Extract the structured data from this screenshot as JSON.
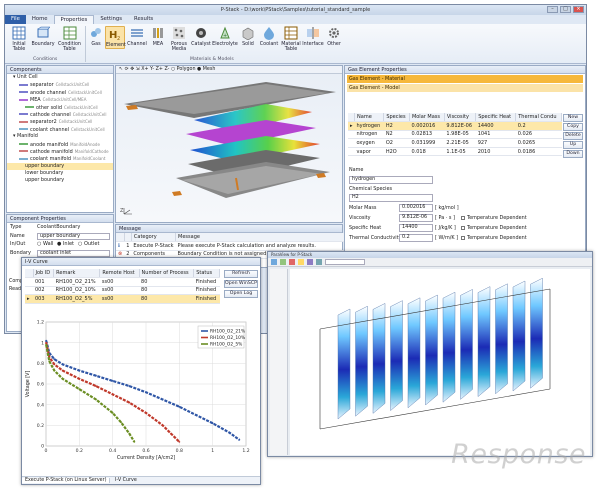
{
  "main_window": {
    "title": "P-Stack - D:\\work\\PStack\\Samples\\tutorial_standard_sample",
    "menu_tabs": [
      "File",
      "Home",
      "Properties",
      "Settings",
      "Results"
    ],
    "active_tab": "Properties",
    "ribbon": {
      "buttons": [
        {
          "label": "Initial\nTable",
          "icon": "table-icon"
        },
        {
          "label": "Boundary",
          "icon": "boundary-icon"
        },
        {
          "label": "Condition\nTable",
          "icon": "condition-table-icon"
        },
        {
          "label": "Gas",
          "icon": "gas-icon"
        },
        {
          "label": "Element",
          "icon": "h2-element-icon"
        },
        {
          "label": "Channel",
          "icon": "channel-icon"
        },
        {
          "label": "MEA",
          "icon": "mea-icon"
        },
        {
          "label": "Porous\nMedia",
          "icon": "porous-media-icon"
        },
        {
          "label": "Catalyst",
          "icon": "catalyst-icon"
        },
        {
          "label": "Electrolyte",
          "icon": "electrolyte-icon"
        },
        {
          "label": "Solid",
          "icon": "solid-icon"
        },
        {
          "label": "Coolant",
          "icon": "coolant-icon"
        },
        {
          "label": "Material\nTable",
          "icon": "material-table-icon"
        },
        {
          "label": "Interface",
          "icon": "interface-icon"
        },
        {
          "label": "Other",
          "icon": "gear-icon"
        }
      ],
      "groups": [
        "Conditions",
        "Materials & Models"
      ]
    },
    "components_panel": {
      "title": "Components",
      "items": [
        {
          "label": "Unit Cell",
          "indent": 1,
          "color": ""
        },
        {
          "label": "separator",
          "indent": 2,
          "color": "#7b7bd0",
          "tag": "CellstackUnitCell"
        },
        {
          "label": "anode channel",
          "indent": 2,
          "color": "#7b7bd0",
          "tag": "CellstackUnitCell"
        },
        {
          "label": "MEA",
          "indent": 2,
          "color": "#b06ad9",
          "tag": "CellstackUnitCell/MEA"
        },
        {
          "label": "other solid",
          "indent": 3,
          "color": "#6cb36c",
          "tag": "CellstackUnitCell"
        },
        {
          "label": "cathode channel",
          "indent": 2,
          "color": "#7b7bd0",
          "tag": "CellstackUnitCell"
        },
        {
          "label": "separator2",
          "indent": 2,
          "color": "#d07b7b",
          "tag": "CellstackUnitCell"
        },
        {
          "label": "coolant channel",
          "indent": 2,
          "color": "#7bb0d0",
          "tag": "CellstackUnitCell"
        },
        {
          "label": "Manifold",
          "indent": 1,
          "color": ""
        },
        {
          "label": "anode manifold",
          "indent": 2,
          "color": "#6cb36c",
          "tag": "ManifoldAnode"
        },
        {
          "label": "cathode manifold",
          "indent": 2,
          "color": "#d07b7b",
          "tag": "ManifoldCathode"
        },
        {
          "label": "coolant manifold",
          "indent": 2,
          "color": "#7bb0d0",
          "tag": "ManifoldCoolant"
        },
        {
          "label": "upper boundary",
          "indent": 3,
          "color": "",
          "tag": "",
          "selected": true
        },
        {
          "label": "lower boundary",
          "indent": 3,
          "color": "",
          "tag": ""
        },
        {
          "label": "upper boundary",
          "indent": 3,
          "color": "",
          "tag": ""
        }
      ]
    },
    "component_properties": {
      "title": "Component Properties",
      "type_label": "Type",
      "type_value": "CoolantBoundary",
      "name_label": "Name",
      "name_value": "upper boundary",
      "inout_label": "In/Out",
      "inout_options": [
        "Wall",
        "Inlet",
        "Outlet"
      ],
      "bondary_label": "Bondary",
      "bondary_value": "coolant inlet",
      "lower_tabs": [
        "Compo",
        "Ready"
      ]
    },
    "viewport_toolbar": {
      "polygon_label": "Polygon",
      "mesh_label": "Mesh"
    },
    "message_panel": {
      "title": "Message",
      "headers": [
        "",
        "",
        "Category",
        "Message"
      ],
      "rows": [
        {
          "num": "1",
          "category": "Execute P-Stack",
          "text": "Please execute P-Stack calculation and analyze results.",
          "level": "info"
        },
        {
          "num": "2",
          "category": "Components",
          "text": "Boundary Condition is not assigned to Coolant Boundary Upper boundary",
          "level": "error"
        }
      ]
    },
    "gas_element": {
      "title": "Gas Element Properties",
      "material_label": "Gas Element - Material",
      "model_label": "Gas Element - Model",
      "headers": [
        "Name",
        "Species",
        "Molar Mass",
        "Viscosity",
        "Specific Heat",
        "Thermal Condu"
      ],
      "rows": [
        [
          "hydrogen",
          "H2",
          "0.002016",
          "9.812E-06",
          "14400",
          "0.2"
        ],
        [
          "nitrogen",
          "N2",
          "0.02813",
          "1.98E-05",
          "1041",
          "0.026"
        ],
        [
          "oxygen",
          "O2",
          "0.031999",
          "2.21E-05",
          "927",
          "0.0265"
        ],
        [
          "vapor",
          "H2O",
          "0.018",
          "1.1E-05",
          "2010",
          "0.0186"
        ]
      ],
      "buttons": [
        "New",
        "Copy",
        "Delete",
        "Up",
        "Down"
      ],
      "detail": {
        "name_label": "Name",
        "name_value": "hydrogen",
        "species_label": "Chemical Species",
        "species_value": "H2",
        "molar_label": "Molar Mass",
        "molar_value": "0.002016",
        "molar_unit": "[ kg/mol ]",
        "visc_label": "Viscosity",
        "visc_value": "9.812E-06",
        "visc_unit": "[ Pa · s ]",
        "visc_dep": "Temperature Dependent",
        "heat_label": "Specific Heat",
        "heat_value": "14400",
        "heat_unit": "[ J/kg/K ]",
        "heat_dep": "Temperature Dependent",
        "cond_label": "Thermal Conductivity",
        "cond_value": "0.2",
        "cond_unit": "[ W/m/K ]",
        "cond_dep": "Temperature Dependent"
      }
    }
  },
  "iv_window": {
    "title": "I-V Curve",
    "table_headers": [
      "",
      "Job ID",
      "Remark",
      "Remote Host",
      "Number of Process",
      "Status"
    ],
    "table_rows": [
      [
        "001",
        "RH100_O2_21%",
        "ss00",
        "80",
        "Finished"
      ],
      [
        "002",
        "RH100_O2_10%",
        "ss00",
        "80",
        "Finished"
      ],
      [
        "003",
        "RH100_O2_5%",
        "ss00",
        "80",
        "Finished"
      ]
    ],
    "selected_row": 2,
    "side_buttons": [
      "Refresh",
      "Open WinSCP",
      "Open Log"
    ],
    "bottom_tabs": [
      "Execute P-Stack (on Linux Server)",
      "I-V Curve"
    ]
  },
  "chart_data": {
    "type": "line",
    "xlabel": "Current Density [A/cm2]",
    "ylabel": "Voltage [V]",
    "xlim": [
      0,
      1.2
    ],
    "ylim": [
      0,
      1.2
    ],
    "xticks": [
      "0",
      "0.2",
      "0.4",
      "0.6",
      "0.8",
      "1",
      "1.2"
    ],
    "yticks": [
      "0",
      "0.2",
      "0.4",
      "0.6",
      "0.8",
      "1",
      "1.2"
    ],
    "legend_position": "top-right",
    "series": [
      {
        "name": "RH100_O2_21%",
        "color": "#2f56a6",
        "x": [
          0.001,
          0.02,
          0.05,
          0.1,
          0.2,
          0.3,
          0.4,
          0.5,
          0.6,
          0.7,
          0.8,
          0.9,
          1.0,
          1.1,
          1.16
        ],
        "y": [
          1.02,
          0.9,
          0.84,
          0.79,
          0.73,
          0.68,
          0.63,
          0.58,
          0.52,
          0.45,
          0.38,
          0.3,
          0.22,
          0.13,
          0.06
        ]
      },
      {
        "name": "RH100_O2_10%",
        "color": "#c0392b",
        "x": [
          0.001,
          0.02,
          0.05,
          0.1,
          0.2,
          0.3,
          0.4,
          0.5,
          0.6,
          0.7,
          0.75,
          0.8
        ],
        "y": [
          1.0,
          0.86,
          0.79,
          0.73,
          0.65,
          0.58,
          0.5,
          0.42,
          0.32,
          0.2,
          0.12,
          0.04
        ]
      },
      {
        "name": "RH100_O2_5%",
        "color": "#6b8e23",
        "x": [
          0.001,
          0.02,
          0.05,
          0.1,
          0.2,
          0.3,
          0.4,
          0.45,
          0.5,
          0.53
        ],
        "y": [
          0.98,
          0.82,
          0.73,
          0.65,
          0.55,
          0.45,
          0.32,
          0.23,
          0.12,
          0.04
        ]
      }
    ]
  },
  "viewer_window": {
    "title": "ParaView for P-Stack",
    "brand_watermark": "Response"
  }
}
